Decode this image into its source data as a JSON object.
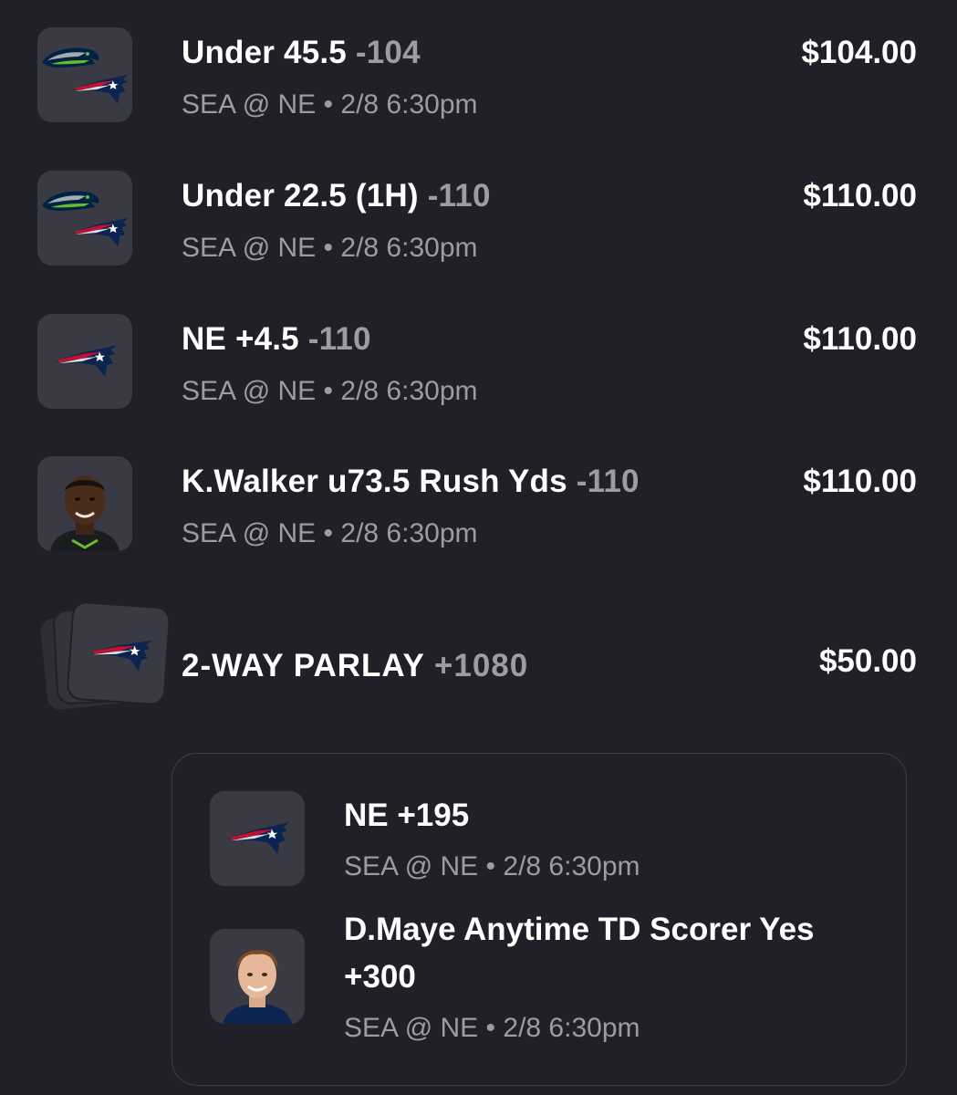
{
  "bets": [
    {
      "market": "Under 45.5",
      "odds": "-104",
      "game": "SEA @ NE",
      "time": "2/8 6:30pm",
      "amount": "$104.00",
      "icon": "seahawks-patriots-logos"
    },
    {
      "market": "Under 22.5 (1H)",
      "odds": "-110",
      "game": "SEA @ NE",
      "time": "2/8 6:30pm",
      "amount": "$110.00",
      "icon": "seahawks-patriots-logos"
    },
    {
      "market": "NE +4.5",
      "odds": "-110",
      "game": "SEA @ NE",
      "time": "2/8 6:30pm",
      "amount": "$110.00",
      "icon": "patriots-logo"
    },
    {
      "market": "K.Walker u73.5 Rush Yds",
      "odds": "-110",
      "game": "SEA @ NE",
      "time": "2/8 6:30pm",
      "amount": "$110.00",
      "icon": "player-headshot"
    }
  ],
  "parlay": {
    "market": "2-WAY PARLAY",
    "odds": "+1080",
    "amount": "$50.00",
    "icon": "stacked-patriots-logo",
    "legs": [
      {
        "line1": "NE +195",
        "line2": "",
        "game": "SEA @ NE",
        "time": "2/8 6:30pm",
        "icon": "patriots-logo"
      },
      {
        "line1": "D.Maye Anytime TD Scorer Yes",
        "line2": "+300",
        "game": "SEA @ NE",
        "time": "2/8 6:30pm",
        "icon": "player-headshot"
      }
    ]
  },
  "separator": "•",
  "colors": {
    "background": "#202028",
    "tile": "#393a44",
    "muted_text": "#9c9ca6",
    "primary_text": "#ffffff",
    "patriots_navy": "#0b2550",
    "patriots_red": "#c8102e",
    "seahawks_navy": "#002244",
    "seahawks_green": "#69be28"
  }
}
